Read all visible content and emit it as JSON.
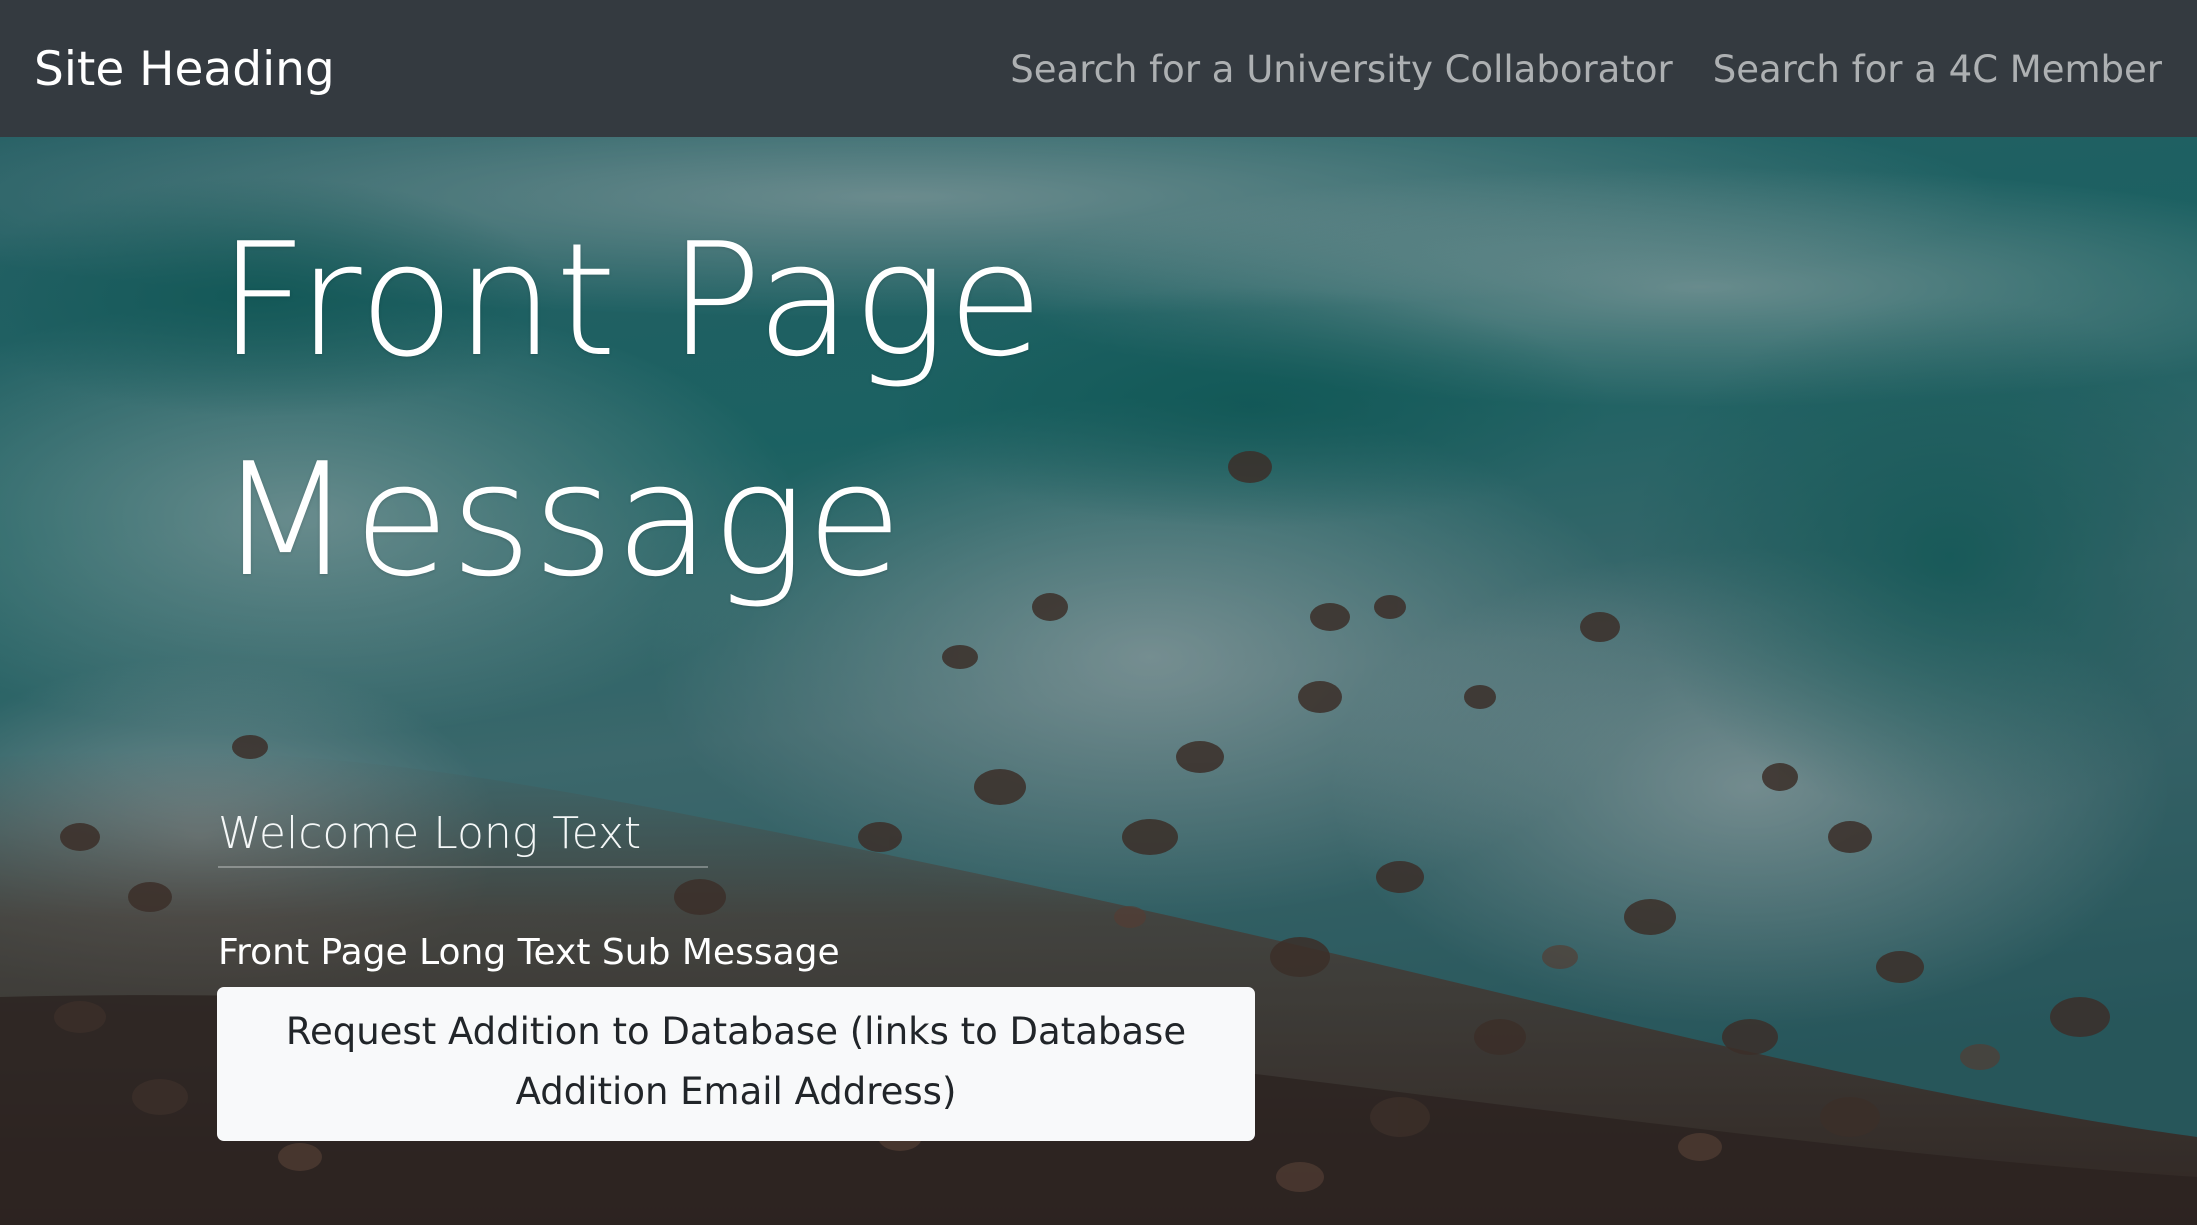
{
  "navbar": {
    "brand": "Site Heading",
    "links": [
      {
        "label": "Search for a University Collaborator"
      },
      {
        "label": "Search for a 4C Member"
      }
    ],
    "background_color": "#343a40"
  },
  "hero": {
    "title_line1": "Front Page",
    "title_line2": "Message",
    "welcome": "Welcome Long Text",
    "sub_message": "Front Page Long Text Sub Message",
    "button_label": "Request Addition to Database (links to Database Addition Email Address)",
    "background_image": "aerial ocean waves over rocky shore"
  },
  "colors": {
    "button_background": "#f8f9fa",
    "button_text": "#212529",
    "hero_text": "#ffffff"
  }
}
